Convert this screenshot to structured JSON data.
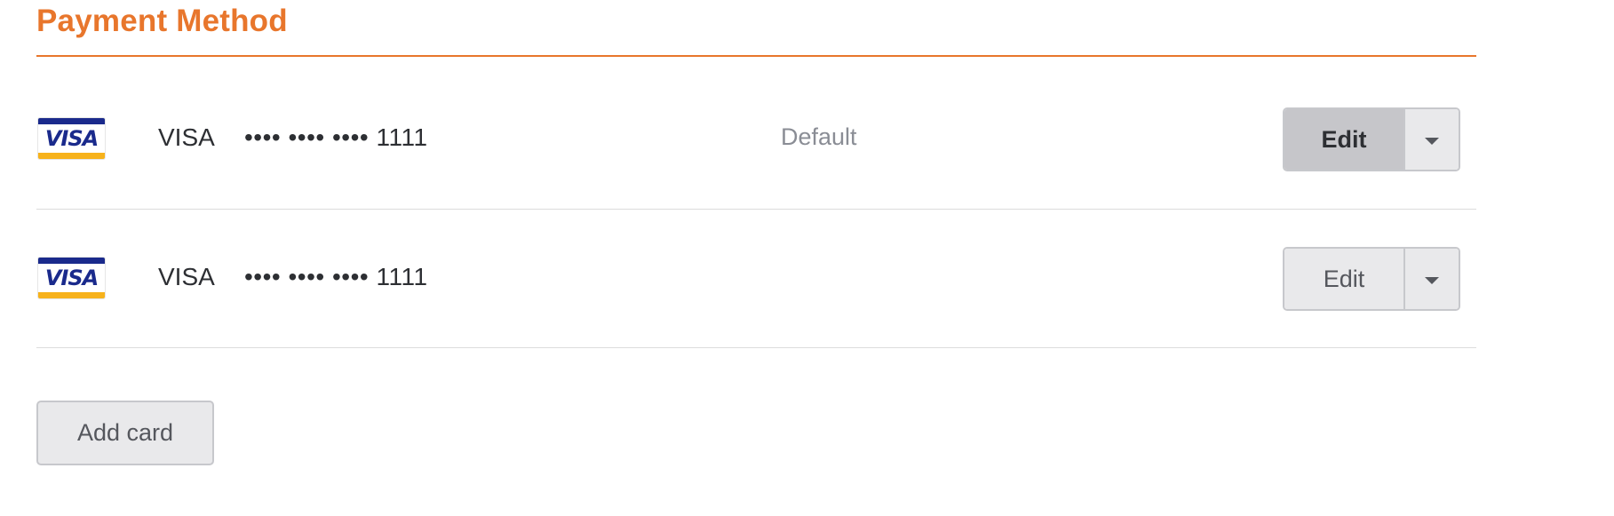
{
  "header": {
    "title": "Payment Method"
  },
  "cards": [
    {
      "brand_icon": "visa-icon",
      "logo_text": "VISA",
      "brand": "VISA",
      "number": "•••• •••• •••• 1111",
      "default_label": "Default",
      "is_default": true,
      "edit_label": "Edit"
    },
    {
      "brand_icon": "visa-icon",
      "logo_text": "VISA",
      "brand": "VISA",
      "number": "•••• •••• •••• 1111",
      "default_label": "",
      "is_default": false,
      "edit_label": "Edit"
    }
  ],
  "actions": {
    "add_card_label": "Add card"
  },
  "colors": {
    "accent": "#e8762c",
    "visa_blue": "#1a2a8c",
    "visa_gold": "#f7b21b",
    "muted_text": "#8a8d95"
  }
}
